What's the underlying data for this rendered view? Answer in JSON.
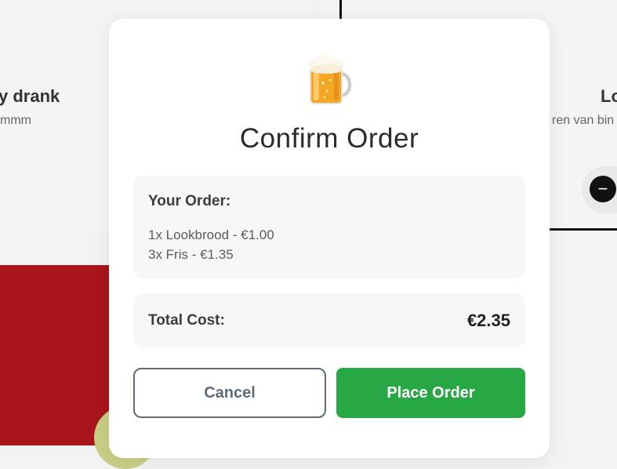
{
  "background": {
    "left_card": {
      "name": "y drank",
      "description": "mmm"
    },
    "right_card": {
      "name": "Lo",
      "description": "ren van bin",
      "decrement_symbol": "−"
    }
  },
  "modal": {
    "icon": "beer-mug-icon",
    "title": "Confirm Order",
    "order": {
      "heading": "Your Order:",
      "items": [
        {
          "text": "1x Lookbrood - €1.00"
        },
        {
          "text": "3x Fris - €1.35"
        }
      ]
    },
    "total": {
      "label": "Total Cost:",
      "value": "€2.35"
    },
    "buttons": {
      "cancel": "Cancel",
      "place": "Place Order"
    }
  },
  "colors": {
    "accent_green": "#28a745",
    "cancel_border": "#5e6b78",
    "panel_bg": "#f6f7f9"
  }
}
